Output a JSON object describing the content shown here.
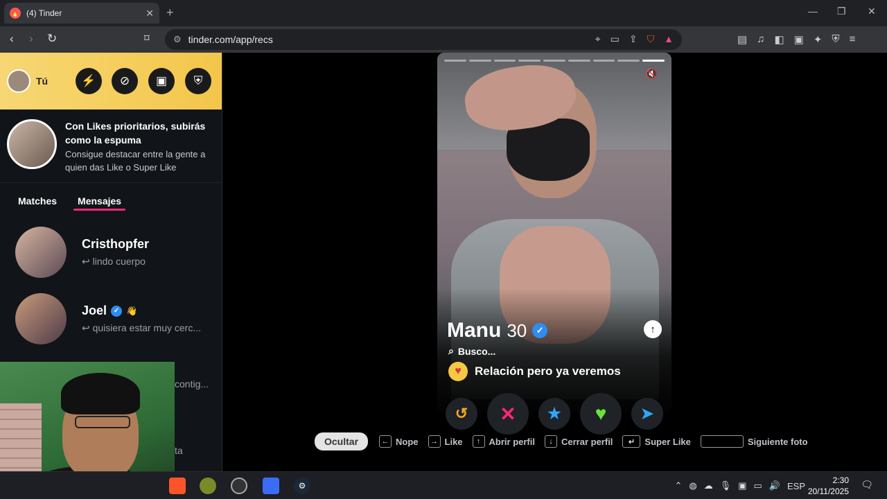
{
  "browser": {
    "tab_title": "(4) Tinder",
    "tab_close": "✕",
    "new_tab": "+",
    "url": "tinder.com/app/recs",
    "window_controls": [
      "—",
      "❐",
      "✕"
    ]
  },
  "sidebar": {
    "me_label": "Tú",
    "header_buttons": [
      "⚡",
      "⊘",
      "▣",
      "⛨"
    ],
    "promo_title": "Con Likes prioritarios, subirás como la espuma",
    "promo_sub": "Consigue destacar entre la gente a quien das Like o Super Like",
    "tabs": [
      "Matches",
      "Mensajes"
    ],
    "messages": [
      {
        "name": "Cristhopfer",
        "preview": "↩ lindo cuerpo",
        "verified": false
      },
      {
        "name": "Joel",
        "preview": "↩ quisiera estar muy cerc...",
        "verified": true
      }
    ],
    "partial_texts": [
      "contig...",
      "ta"
    ]
  },
  "profile": {
    "name": "Manu",
    "age": "30",
    "busco": "Busco...",
    "relation": "Relación pero ya veremos",
    "photos_total": 9,
    "photo_current": 9
  },
  "actions": {
    "rewind": "↺",
    "nope": "✕",
    "superlike": "★",
    "like": "♥",
    "boost": "➤"
  },
  "shortcuts": {
    "hide": "Ocultar",
    "nope": "Nope",
    "like": "Like",
    "open": "Abrir perfil",
    "close": "Cerrar perfil",
    "superlike": "Super Like",
    "next": "Siguiente foto"
  },
  "taskbar": {
    "lang": "ESP",
    "time": "2:30",
    "date": "20/11/2025"
  }
}
